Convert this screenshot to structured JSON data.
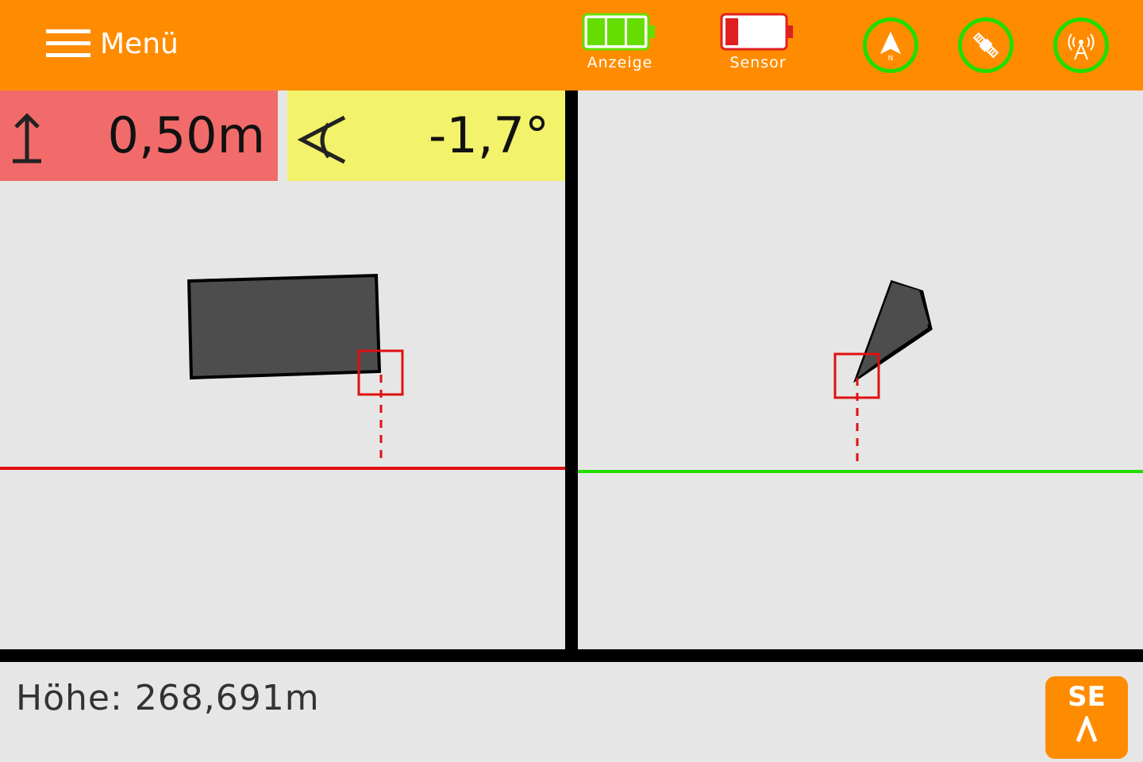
{
  "header": {
    "menu_label": "Menü",
    "battery_display": {
      "label": "Anzeige",
      "level": 0.85,
      "color": "#66dd00"
    },
    "battery_sensor": {
      "label": "Sensor",
      "level": 0.2,
      "color": "#e02020"
    },
    "status_ok_color": "#22dd00",
    "status_icons": [
      "navigation-icon",
      "satellite-icon",
      "radio-tower-icon"
    ]
  },
  "readouts": {
    "height_offset": "0,50m",
    "angle": "-1,7°"
  },
  "footer": {
    "elevation_text": "Höhe: 268,691m",
    "compass_direction": "SE"
  }
}
